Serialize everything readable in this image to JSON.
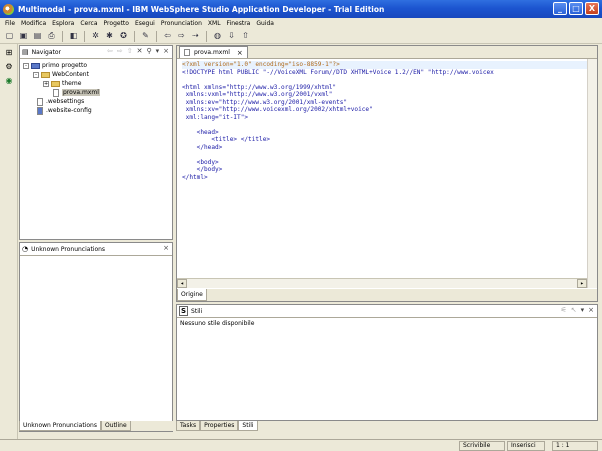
{
  "window": {
    "title": "Multimodal - prova.mxml - IBM WebSphere Studio Application Developer - Trial Edition",
    "controls": [
      "_",
      "□",
      "X"
    ]
  },
  "menu": [
    "File",
    "Modifica",
    "Esplora",
    "Cerca",
    "Progetto",
    "Esegui",
    "Pronunciation",
    "XML",
    "Finestra",
    "Guida"
  ],
  "navigator": {
    "tab_label": "Navigator",
    "close": "×",
    "tree": {
      "project": "primo progetto",
      "webcontent": "WebContent",
      "theme": "theme",
      "file": "prova.mxml",
      "websettings": ".websettings",
      "websiteconfig": ".website-config"
    }
  },
  "pronunciations_panel": {
    "tab_label": "Unknown Pronunciations",
    "close": "×",
    "bottom_tabs": [
      "Unknown Pronunciations",
      "Outline"
    ]
  },
  "editor": {
    "tab_label": "prova.mxml",
    "close": "×",
    "code": [
      "<?xml version=\"1.0\" encoding=\"iso-8859-1\"?>",
      "<!DOCTYPE html PUBLIC \"-//VoiceXML Forum//DTD XHTML+Voice 1.2//EN\" \"http://www.voicex",
      "",
      "<html xmlns=\"http://www.w3.org/1999/xhtml\"",
      " xmlns:vxml=\"http://www.w3.org/2001/vxml\"",
      " xmlns:ev=\"http://www.w3.org/2001/xml-events\"",
      " xmlns:xv=\"http://www.voicexml.org/2002/xhtml+voice\"",
      " xml:lang=\"it-IT\">",
      "",
      "    <head>",
      "        <title> </title>",
      "    </head>",
      "",
      "    <body>",
      "    </body>",
      "</html>"
    ],
    "bottom_tab": "Origine"
  },
  "styles_panel": {
    "tab_label": "Stili",
    "close": "×",
    "content": "Nessuno stile disponibile",
    "bottom_tabs": [
      "Tasks",
      "Properties",
      "Stili"
    ]
  },
  "status": {
    "mode": "Scrivibile",
    "insert": "Inserisci",
    "position": "1 : 1"
  }
}
